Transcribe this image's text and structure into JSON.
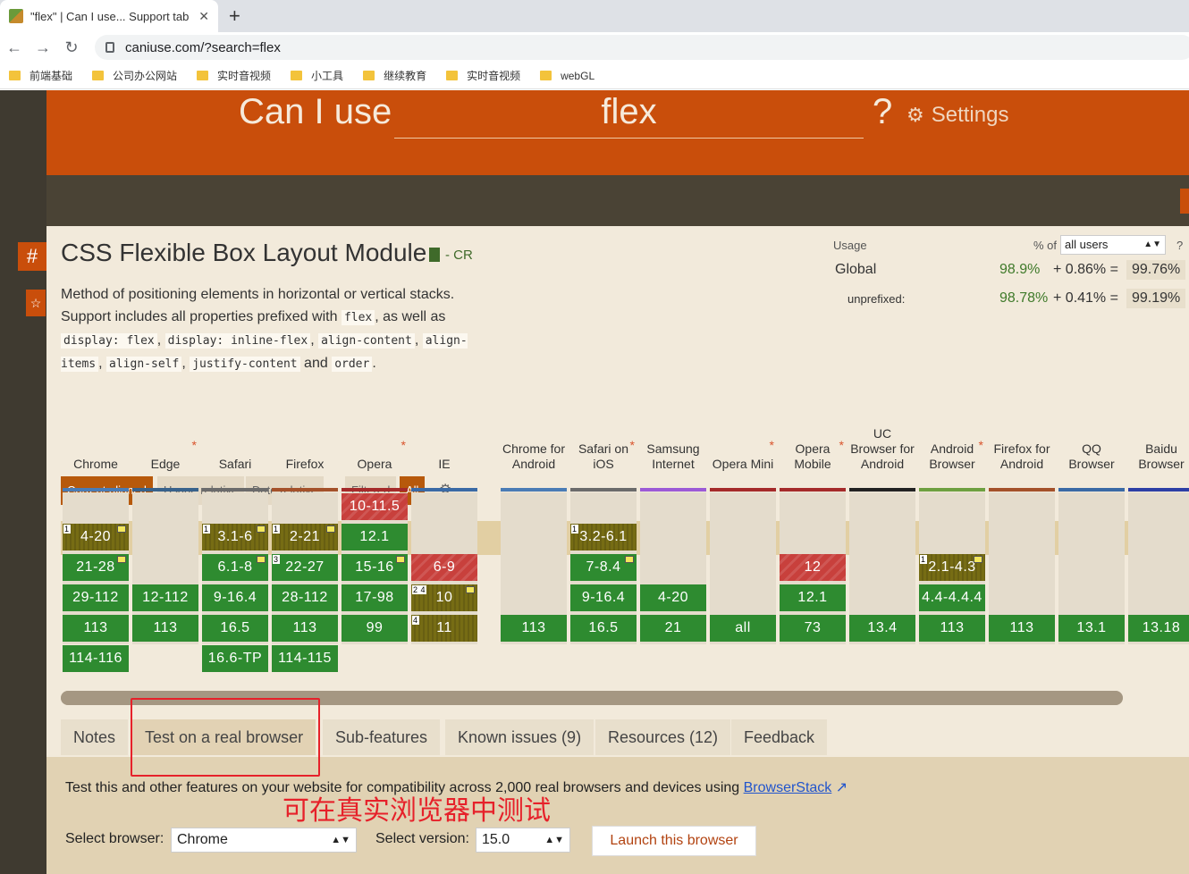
{
  "browser": {
    "tab_title": "\"flex\" | Can I use... Support tab",
    "close": "✕",
    "new_tab": "+",
    "url": "caniuse.com/?search=flex",
    "bookmarks": [
      "前端基础",
      "公司办公网站",
      "实时音视频",
      "小工具",
      "继续教育",
      "实时音视频",
      "webGL"
    ]
  },
  "header": {
    "caniuse": "Can I use",
    "search_value": "flex",
    "question": "?",
    "settings": "Settings"
  },
  "side": {
    "hash": "#",
    "star": "☆"
  },
  "feature": {
    "title": "CSS Flexible Box Layout Module",
    "status": "- CR",
    "desc_1": "Method of positioning elements in horizontal or vertical stacks. Support includes all properties prefixed with ",
    "code_flex": "flex",
    "desc_2": ", as well as ",
    "code_1": "display: flex",
    "code_2": "display: inline-flex",
    "code_3": "align-content",
    "code_4": "align-items",
    "code_5": "align-self",
    "code_6": "justify-content",
    "and": " and ",
    "code_7": "order",
    "comma": ", ",
    "period": "."
  },
  "usage": {
    "label": "Usage",
    "pct_of": "% of",
    "users": "all users",
    "help": "?",
    "global_label": "Global",
    "global_a": "98.9%",
    "global_b": "+ 0.86% =",
    "global_total": "99.76%",
    "unprefixed_label": "unprefixed:",
    "unp_a": "98.78%",
    "unp_b": "+ 0.41% =",
    "unp_total": "99.19%"
  },
  "view_buttons": {
    "current": "Current aligned",
    "usage_rel": "Usage relative",
    "date_rel": "Date relative",
    "filtered": "Filtered",
    "all": "All"
  },
  "browsers": [
    {
      "name": "Chrome",
      "color": "#4a7cb5"
    },
    {
      "name": "Edge",
      "color": "#38628b"
    },
    {
      "name": "Safari",
      "color": "#6b6b6b"
    },
    {
      "name": "Firefox",
      "color": "#a4512a"
    },
    {
      "name": "Opera",
      "color": "#a52a2a"
    },
    {
      "name": "IE",
      "color": "#3a6aa5"
    },
    {
      "name": "Chrome for Android",
      "color": "#4a7cb5"
    },
    {
      "name": "Safari on iOS",
      "color": "#6b6b6b"
    },
    {
      "name": "Samsung Internet",
      "color": "#9c5ad6"
    },
    {
      "name": "Opera Mini",
      "color": "#a52a2a"
    },
    {
      "name": "Opera Mobile",
      "color": "#a52a2a"
    },
    {
      "name": "UC Browser for Android",
      "color": "#222222"
    },
    {
      "name": "Android Browser",
      "color": "#6ea040"
    },
    {
      "name": "Firefox for Android",
      "color": "#a4512a"
    },
    {
      "name": "QQ Browser",
      "color": "#3a6aa5"
    },
    {
      "name": "Baidu Browser",
      "color": "#2d3fa5"
    }
  ],
  "cells": {
    "chrome": [
      "4-20",
      "21-28",
      "29-112",
      "113",
      "114-116"
    ],
    "edge": [
      "12-112",
      "113"
    ],
    "safari": [
      "3.1-6",
      "6.1-8",
      "9-16.4",
      "16.5",
      "16.6-TP"
    ],
    "firefox": [
      "2-21",
      "22-27",
      "28-112",
      "113",
      "114-115"
    ],
    "opera": [
      "10-11.5",
      "12.1",
      "15-16",
      "17-98",
      "99"
    ],
    "ie": [
      "6-9",
      "10",
      "11"
    ],
    "chrome_android": "113",
    "safari_ios": [
      "3.2-6.1",
      "7-8.4",
      "9-16.4",
      "16.5"
    ],
    "samsung": [
      "4-20",
      "21"
    ],
    "opera_mini": "all",
    "opera_mobile": [
      "12",
      "12.1",
      "73"
    ],
    "uc": "13.4",
    "android": [
      "2.1-4.3",
      "4.4-4.4.4",
      "113"
    ],
    "firefox_android": "113",
    "qq": "13.1",
    "baidu": "13.18",
    "notes": {
      "n1": "1",
      "n3": "3",
      "n24": "2 4",
      "n4": "4"
    }
  },
  "tabs": [
    "Notes",
    "Test on a real browser",
    "Sub-features",
    "Known issues (9)",
    "Resources (12)",
    "Feedback"
  ],
  "panel": {
    "text": "Test this and other features on your website for compatibility across 2,000 real browsers and devices using ",
    "link": "BrowserStack",
    "select_browser_label": "Select browser:",
    "browser_value": "Chrome",
    "select_version_label": "Select version:",
    "version_value": "15.0",
    "launch": "Launch this browser"
  },
  "annotation": "可在真实浏览器中测试",
  "colors": {
    "header": "#c94e0b",
    "supported": "#2e8b30",
    "partial": "#766c14",
    "unsupported": "#c8403c",
    "annotation": "#e6212a"
  }
}
